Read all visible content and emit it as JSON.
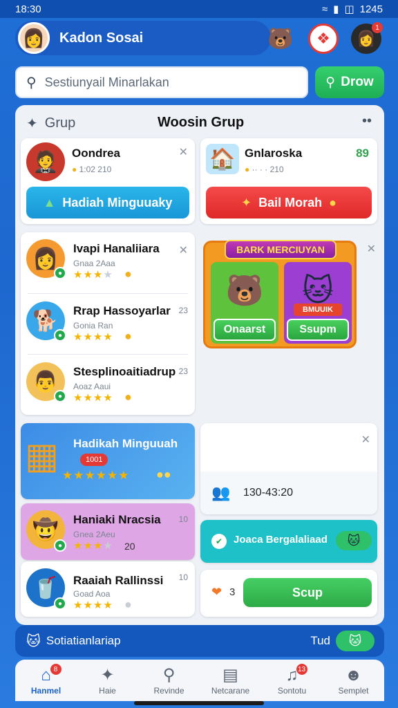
{
  "status_bar": {
    "time": "18:30",
    "right_text": "1245",
    "icons": [
      "wifi-icon",
      "signal-icon",
      "battery-icon"
    ]
  },
  "header": {
    "profile_name": "Kadon Sosai",
    "icons": [
      "mascot-icon",
      "gift-icon",
      "user-avatar"
    ],
    "notification_count": "1"
  },
  "search": {
    "placeholder": "Sestiunyail Minarlakan",
    "button_label": "Drow"
  },
  "panel": {
    "left_title": "Grup",
    "center_title": "Woosin Grup"
  },
  "featured_left": {
    "name": "Oondrea",
    "meta": "1:02 210",
    "button_label": "Hadiah Minguuaky"
  },
  "featured_right": {
    "name": "Gnlaroska",
    "meta": "·· · · 210",
    "score": "89",
    "button_label": "Bail Morah"
  },
  "friends": [
    {
      "name": "Ivapi Hanaliiara",
      "sub": "Gnaa 2Aaa",
      "stars": 3,
      "side": ""
    },
    {
      "name": "Rrap Hassoyarlar",
      "sub": "Gonia Ran",
      "stars": 4,
      "side": "23"
    },
    {
      "name": "Stesplinoaitiadrup",
      "sub": "Aoaz Aaui",
      "stars": 4,
      "side": "23"
    }
  ],
  "promo": {
    "title": "BARK MERCIUYAN",
    "left_button": "Onaarst",
    "right_button": "Ssupm",
    "right_tag": "BMUUIK"
  },
  "reward_card": {
    "title": "Hadikah Minguuah",
    "tag": "1001",
    "stars": 5
  },
  "info_card": {
    "value": "130-43:20"
  },
  "friends2": [
    {
      "name": "Haniaki Nracsia",
      "sub": "Gnea 2Aeu",
      "stars": 3,
      "extra": "20",
      "side": "10"
    },
    {
      "name": "Raaiah Rallinssi",
      "sub": "Goad Aoa",
      "stars": 4,
      "extra": "",
      "side": "10"
    }
  ],
  "join_card": {
    "label": "Joaca Bergalaliaad"
  },
  "scup_card": {
    "count": "3",
    "button_label": "Scup"
  },
  "bottom_banner": {
    "label": "Sotiatianlariap",
    "right_label": "Tud"
  },
  "nav": [
    {
      "label": "Hanmel",
      "icon": "home-icon",
      "badge": "8",
      "active": true
    },
    {
      "label": "Haie",
      "icon": "explore-icon",
      "badge": "",
      "active": false
    },
    {
      "label": "Revinde",
      "icon": "chat-icon",
      "badge": "",
      "active": false
    },
    {
      "label": "Netcarane",
      "icon": "news-icon",
      "badge": "",
      "active": false
    },
    {
      "label": "Sontotu",
      "icon": "music-icon",
      "badge": "13",
      "active": false
    },
    {
      "label": "Semplet",
      "icon": "profile-icon",
      "badge": "",
      "active": false
    }
  ],
  "colors": {
    "brand_blue": "#1d68cf",
    "green": "#22b45a",
    "red": "#ef3b3b",
    "cyan": "#1ec1c7"
  }
}
